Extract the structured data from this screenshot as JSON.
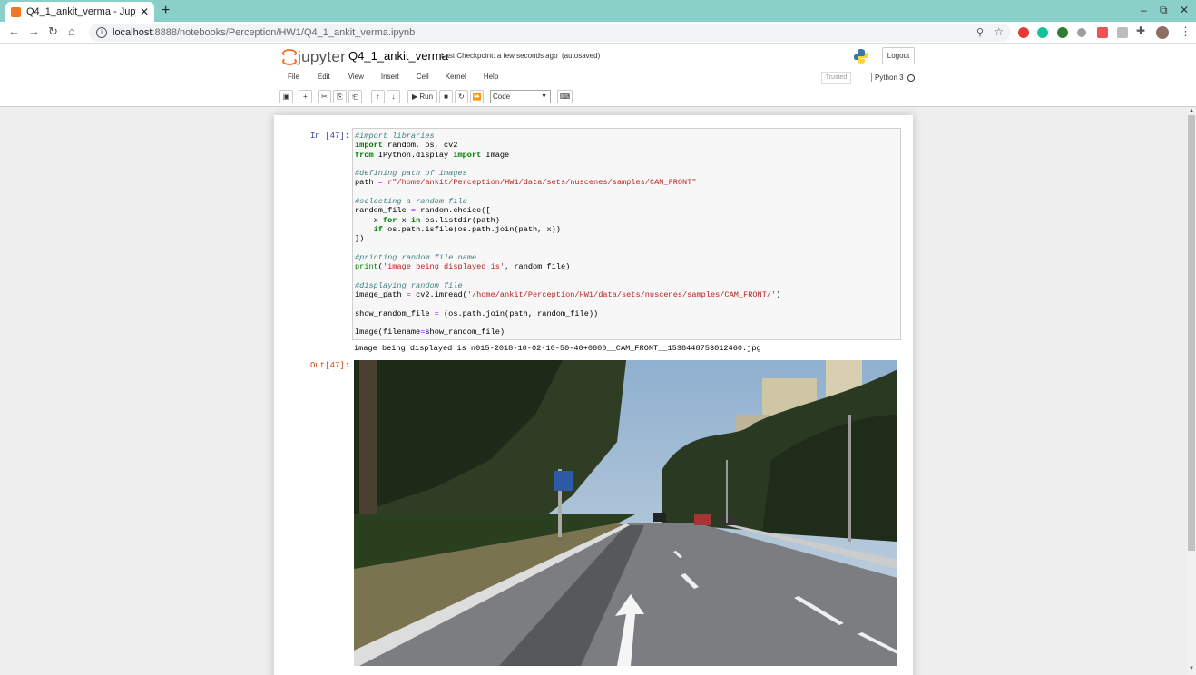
{
  "browser": {
    "tab_title": "Q4_1_ankit_verma - Jupyt",
    "tab_close": "✕",
    "new_tab": "+",
    "url_host": "localhost",
    "url_path": ":8888/notebooks/Perception/HW1/Q4_1_ankit_verma.ipynb",
    "window_controls": [
      "–",
      "⧉",
      "✕"
    ]
  },
  "jupyter": {
    "logo_text": "jupyter",
    "notebook_name": "Q4_1_ankit_verma",
    "checkpoint": "Last Checkpoint: a few seconds ago",
    "autosave": "(autosaved)",
    "logout_label": "Logout",
    "menu": [
      "File",
      "Edit",
      "View",
      "Insert",
      "Cell",
      "Kernel",
      "Help"
    ],
    "trusted_label": "Trusted",
    "kernel_name": "Python 3",
    "run_label": "▶ Run",
    "cell_type": "Code"
  },
  "cell": {
    "in_prompt": "In [47]:",
    "out_prompt": "Out[47]:",
    "stream_output": "image being displayed is n015-2018-10-02-10-50-40+0800__CAM_FRONT__1538448753012460.jpg"
  },
  "colors": {
    "tab_bar": "#8bd0c8",
    "jupyter_orange": "#f37626",
    "in_prompt": "#303f9f",
    "out_prompt": "#d84315"
  }
}
